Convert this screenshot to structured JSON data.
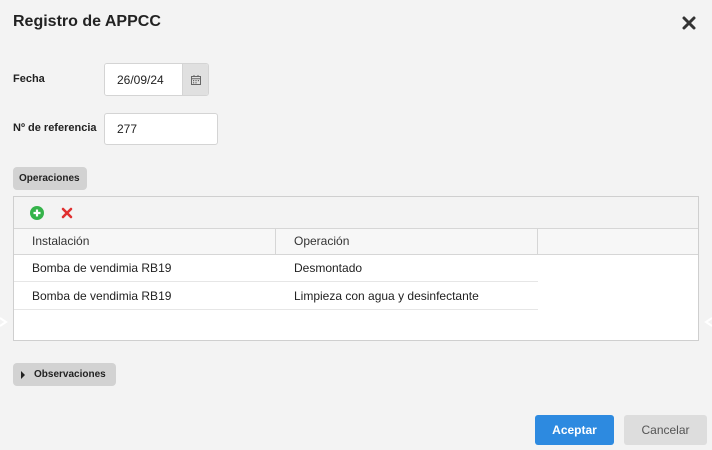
{
  "dialog": {
    "title": "Registro de APPCC",
    "close_icon": "close-icon"
  },
  "form": {
    "fecha_label": "Fecha",
    "fecha_value": "26/09/24",
    "calendar_icon": "calendar-icon",
    "referencia_label": "Nº de referencia",
    "referencia_value": "277"
  },
  "operaciones": {
    "tab_label": "Operaciones",
    "add_icon": "add-circle-icon",
    "delete_icon": "delete-x-icon",
    "add_color": "#35b34a",
    "delete_color": "#e03030",
    "columns": [
      "Instalación",
      "Operación"
    ],
    "rows": [
      {
        "instalacion": "Bomba de vendimia RB19",
        "operacion": "Desmontado"
      },
      {
        "instalacion": "Bomba de vendimia RB19",
        "operacion": "Limpieza con agua y desinfectante"
      }
    ]
  },
  "observaciones": {
    "tab_label": "Observaciones"
  },
  "buttons": {
    "accept_label": "Aceptar",
    "cancel_label": "Cancelar",
    "accent_color": "#2d8ae0"
  }
}
